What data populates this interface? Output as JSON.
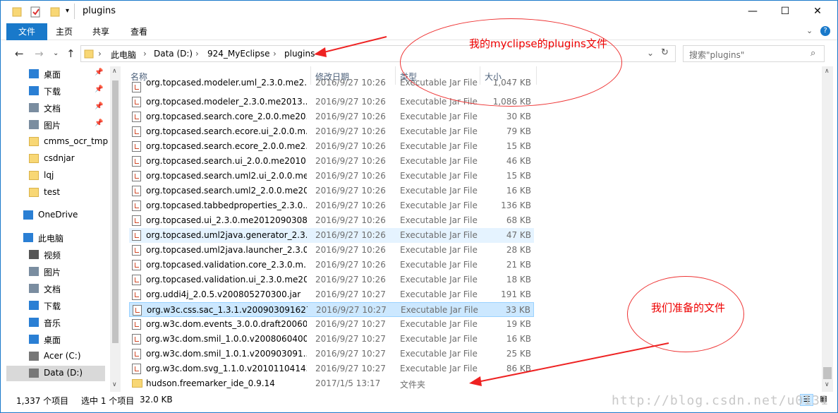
{
  "window": {
    "title": "plugins",
    "controls": {
      "minimize": "—",
      "maximize": "☐",
      "close": "✕"
    }
  },
  "ribbon": {
    "tabs": [
      "文件",
      "主页",
      "共享",
      "查看"
    ]
  },
  "address": {
    "crumbs": [
      "此电脑",
      "Data (D:)",
      "924_MyEclipse",
      "plugins"
    ],
    "separator": "›"
  },
  "search": {
    "placeholder": "搜索\"plugins\""
  },
  "nav_pane": {
    "items": [
      {
        "label": "桌面",
        "icon": "desktop-icon",
        "pinned": true
      },
      {
        "label": "下载",
        "icon": "download-icon",
        "pinned": true
      },
      {
        "label": "文档",
        "icon": "documents-icon",
        "pinned": true
      },
      {
        "label": "图片",
        "icon": "pictures-icon",
        "pinned": true
      },
      {
        "label": "cmms_ocr_tmp",
        "icon": "folder-icon"
      },
      {
        "label": "csdnjar",
        "icon": "folder-icon"
      },
      {
        "label": "lqj",
        "icon": "folder-icon"
      },
      {
        "label": "test",
        "icon": "folder-icon"
      },
      {
        "label": "OneDrive",
        "icon": "onedrive-icon"
      },
      {
        "label": "此电脑",
        "icon": "this-pc-icon"
      },
      {
        "label": "视频",
        "icon": "videos-icon"
      },
      {
        "label": "图片",
        "icon": "pictures-icon"
      },
      {
        "label": "文档",
        "icon": "documents-icon"
      },
      {
        "label": "下载",
        "icon": "download-icon"
      },
      {
        "label": "音乐",
        "icon": "music-icon"
      },
      {
        "label": "桌面",
        "icon": "desktop-icon"
      },
      {
        "label": "Acer (C:)",
        "icon": "drive-icon"
      },
      {
        "label": "Data (D:)",
        "icon": "drive-icon",
        "selected": true
      }
    ]
  },
  "columns": [
    "名称",
    "修改日期",
    "类型",
    "大小"
  ],
  "files": [
    {
      "name": "org.topcased.modeler.uml_2.3.0.me2...",
      "date": "2016/9/27 10:26",
      "type": "Executable Jar File",
      "size": "1,047 KB"
    },
    {
      "name": "org.topcased.modeler_2.3.0.me2013...",
      "date": "2016/9/27 10:26",
      "type": "Executable Jar File",
      "size": "1,086 KB"
    },
    {
      "name": "org.topcased.search.core_2.0.0.me20...",
      "date": "2016/9/27 10:26",
      "type": "Executable Jar File",
      "size": "30 KB"
    },
    {
      "name": "org.topcased.search.ecore.ui_2.0.0.m...",
      "date": "2016/9/27 10:26",
      "type": "Executable Jar File",
      "size": "79 KB"
    },
    {
      "name": "org.topcased.search.ecore_2.0.0.me2...",
      "date": "2016/9/27 10:26",
      "type": "Executable Jar File",
      "size": "15 KB"
    },
    {
      "name": "org.topcased.search.ui_2.0.0.me2010...",
      "date": "2016/9/27 10:26",
      "type": "Executable Jar File",
      "size": "46 KB"
    },
    {
      "name": "org.topcased.search.uml2.ui_2.0.0.me...",
      "date": "2016/9/27 10:26",
      "type": "Executable Jar File",
      "size": "15 KB"
    },
    {
      "name": "org.topcased.search.uml2_2.0.0.me20...",
      "date": "2016/9/27 10:26",
      "type": "Executable Jar File",
      "size": "16 KB"
    },
    {
      "name": "org.topcased.tabbedproperties_2.3.0...",
      "date": "2016/9/27 10:26",
      "type": "Executable Jar File",
      "size": "136 KB"
    },
    {
      "name": "org.topcased.ui_2.3.0.me2012090308...",
      "date": "2016/9/27 10:26",
      "type": "Executable Jar File",
      "size": "68 KB"
    },
    {
      "name": "org.topcased.uml2java.generator_2.3...",
      "date": "2016/9/27 10:26",
      "type": "Executable Jar File",
      "size": "47 KB",
      "hover": true
    },
    {
      "name": "org.topcased.uml2java.launcher_2.3.0...",
      "date": "2016/9/27 10:26",
      "type": "Executable Jar File",
      "size": "28 KB"
    },
    {
      "name": "org.topcased.validation.core_2.3.0.m...",
      "date": "2016/9/27 10:26",
      "type": "Executable Jar File",
      "size": "21 KB"
    },
    {
      "name": "org.topcased.validation.ui_2.3.0.me20...",
      "date": "2016/9/27 10:26",
      "type": "Executable Jar File",
      "size": "18 KB"
    },
    {
      "name": "org.uddi4j_2.0.5.v200805270300.jar",
      "date": "2016/9/27 10:27",
      "type": "Executable Jar File",
      "size": "191 KB"
    },
    {
      "name": "org.w3c.css.sac_1.3.1.v200903091627....",
      "date": "2016/9/27 10:27",
      "type": "Executable Jar File",
      "size": "33 KB",
      "selected": true
    },
    {
      "name": "org.w3c.dom.events_3.0.0.draft20060...",
      "date": "2016/9/27 10:27",
      "type": "Executable Jar File",
      "size": "19 KB"
    },
    {
      "name": "org.w3c.dom.smil_1.0.0.v2008060400...",
      "date": "2016/9/27 10:27",
      "type": "Executable Jar File",
      "size": "16 KB"
    },
    {
      "name": "org.w3c.dom.smil_1.0.1.v200903091...",
      "date": "2016/9/27 10:27",
      "type": "Executable Jar File",
      "size": "25 KB"
    },
    {
      "name": "org.w3c.dom.svg_1.1.0.v20101104143...",
      "date": "2016/9/27 10:27",
      "type": "Executable Jar File",
      "size": "86 KB"
    },
    {
      "name": "hudson.freemarker_ide_0.9.14",
      "date": "2017/1/5 13:17",
      "type": "文件夹",
      "size": "",
      "folder": true
    }
  ],
  "status": {
    "count": "1,337 个项目",
    "selection": "选中 1 个项目",
    "size": "32.0 KB"
  },
  "annotations": {
    "top": "我的myclipse的plugins文件",
    "bottom": "我们准备的文件",
    "watermark": "http://blog.csdn.net/u0131"
  },
  "colors": {
    "accent": "#1979ca",
    "annotation": "#ee2222",
    "selected_row": "#cce8ff"
  }
}
